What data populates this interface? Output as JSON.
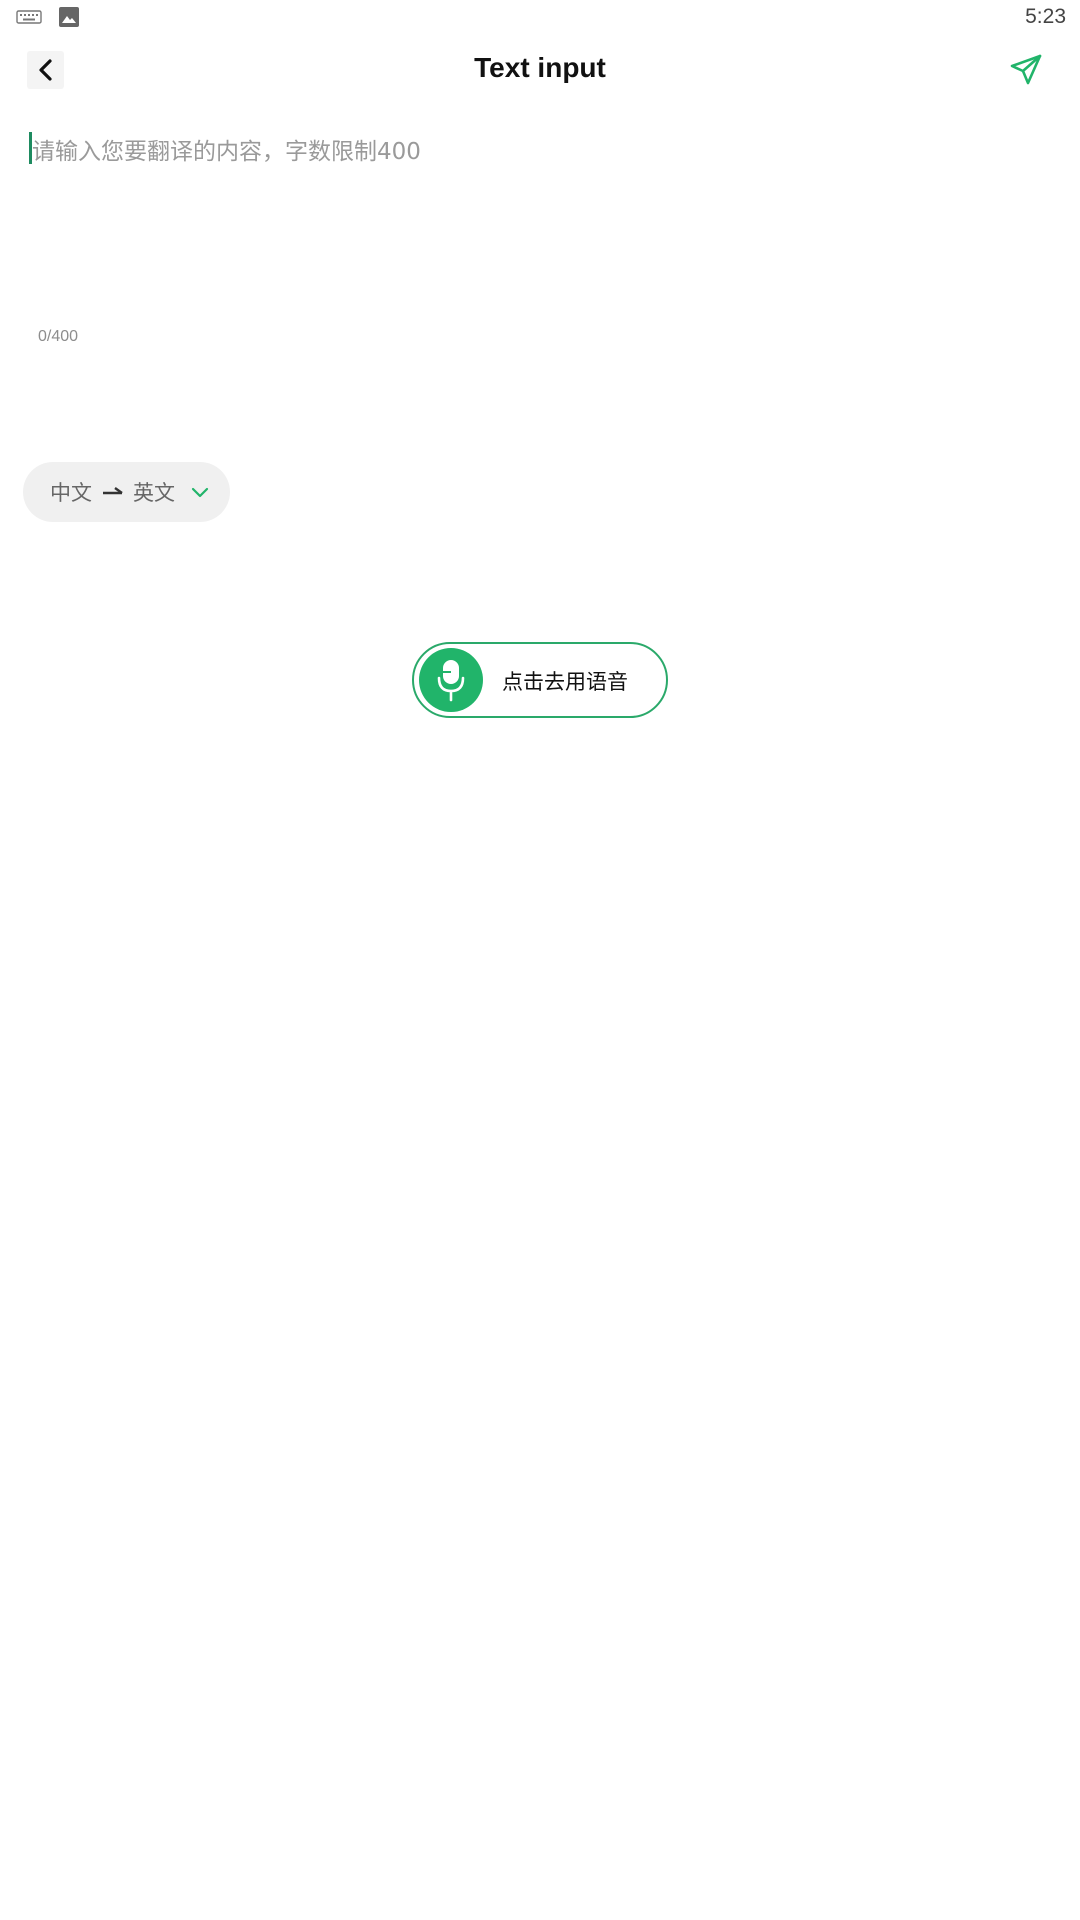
{
  "status_bar": {
    "time": "5:23",
    "icons": [
      "keyboard-icon",
      "image-icon"
    ]
  },
  "app_bar": {
    "title": "Text input",
    "back_icon": "chevron-left-icon",
    "send_icon": "paper-plane-icon"
  },
  "input": {
    "placeholder": "请输入您要翻译的内容，字数限制400",
    "value": "",
    "counter": "0/400"
  },
  "language": {
    "source": "中文",
    "target": "英文",
    "arrow_icon": "arrow-right-icon",
    "dropdown_icon": "chevron-down-icon"
  },
  "voice": {
    "label": "点击去用语音",
    "icon": "microphone-icon"
  },
  "colors": {
    "accent": "#21b46a",
    "accent_border": "#2aa96a",
    "pill_bg": "#f0f0f0",
    "placeholder": "#9a9a9a"
  }
}
